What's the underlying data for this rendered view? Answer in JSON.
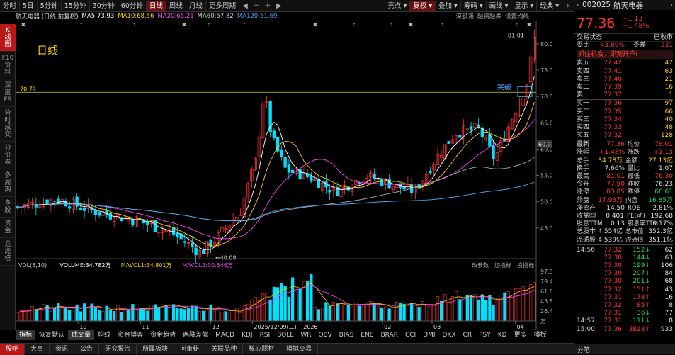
{
  "toolbar": {
    "left": [
      "分时",
      "5日",
      "5分钟",
      "15分钟",
      "30分钟",
      "60分钟",
      "日线",
      "周线",
      "月线",
      "更多周期"
    ],
    "active": "日线",
    "right": [
      "亮点",
      "复权",
      "叠加",
      "筹码",
      "画线",
      "显示",
      "经典"
    ]
  },
  "info": {
    "title": "航天电器 (日线,前复权)",
    "ma": [
      {
        "t": "MA5:73.93",
        "c": "#ffffff"
      },
      {
        "t": "MA10:68.56",
        "c": "#ffcc00"
      },
      {
        "t": "MA20:65.21",
        "c": "#ff44ff"
      },
      {
        "t": "MA60:57.82",
        "c": "#cccccc"
      },
      {
        "t": "MA120:51.69",
        "c": "#44aaff"
      }
    ],
    "right": [
      "深股通",
      "融资融券",
      "设置均线"
    ]
  },
  "left_tabs": [
    {
      "t": "K\n线\n图",
      "active": true
    },
    {
      "t": "F10\n资\n料"
    },
    {
      "t": "深\n度\nF9"
    },
    {
      "t": "分\n时\n成\n交"
    },
    {
      "t": "分\n价\n表"
    },
    {
      "t": "多\n周\n期"
    },
    {
      "t": "多\n股"
    },
    {
      "t": "资\n金"
    },
    {
      "t": "龙\n虎\n榜"
    }
  ],
  "chart_labels": {
    "period": "日线",
    "breakout": "突破",
    "hline": "70.79",
    "high": "81.01",
    "low": "40.08",
    "cur_price": "60.92"
  },
  "y_ticks": [
    "80.00",
    "75.00",
    "70.00",
    "65.00",
    "60.00",
    "55.00",
    "50.00",
    "45.00"
  ],
  "vol": {
    "info": [
      {
        "t": "VOL(5,10)",
        "c": "#cccccc"
      },
      {
        "t": "VOLUME:34.782万",
        "c": "#ffffff"
      },
      {
        "t": "MAVOL1:34.801万",
        "c": "#ffcc00"
      },
      {
        "t": "MAVOL2:30.546万",
        "c": "#ff44ff"
      }
    ],
    "right": [
      "改参数",
      "加指标",
      "换指标"
    ],
    "y_ticks": [
      "97.30",
      "79.47",
      "61.63",
      "43.82",
      "26.40",
      "万"
    ]
  },
  "x_ticks": [
    {
      "t": "10",
      "p": 0.12
    },
    {
      "t": "11",
      "p": 0.24
    },
    {
      "t": "12",
      "p": 0.375
    },
    {
      "t": "2025/12/09(二)",
      "p": 0.455
    },
    {
      "t": "2026",
      "p": 0.55
    },
    {
      "t": "02",
      "p": 0.705
    },
    {
      "t": "03",
      "p": 0.8
    },
    {
      "t": "04",
      "p": 0.96
    }
  ],
  "bottom_tabs": [
    "指标",
    "恢复默认",
    "成交量",
    "均线",
    "资金博弈",
    "资金趋势",
    "两融差额",
    "MACD",
    "KDJ",
    "RSI",
    "BOLL",
    "WR",
    "OBV",
    "BIAS",
    "ENE",
    "BRAR",
    "CCI",
    "DMI",
    "DKX",
    "CR",
    "PSY",
    "KD",
    "更多",
    "模板"
  ],
  "bottom_active": [
    "指标",
    "成交量"
  ],
  "footer": [
    "股吧",
    "大事",
    "资讯",
    "公告",
    "研究报告",
    "所属板块",
    "问董秘",
    "关联品种",
    "核心题材",
    "模拟交易"
  ],
  "quote": {
    "code": "002025",
    "name": "航天电器",
    "price": "77.36",
    "chg": "+1.13",
    "pct": "+1.48%",
    "status_label": "交易状态",
    "status": "已收市",
    "webi": "委比",
    "webi_v": "43.89%",
    "wecha": "委差",
    "wecha_v": "231",
    "promo": "抓住机会，即刻开户!",
    "sell": [
      [
        "卖五",
        "77.42",
        "47"
      ],
      [
        "卖四",
        "77.41",
        "63"
      ],
      [
        "卖三",
        "77.40",
        "21"
      ],
      [
        "卖二",
        "77.39",
        "16"
      ],
      [
        "卖一",
        "77.37",
        "1"
      ]
    ],
    "buy": [
      [
        "买一",
        "77.36",
        "97"
      ],
      [
        "买二",
        "77.35",
        "66"
      ],
      [
        "买三",
        "77.34",
        "40"
      ],
      [
        "买四",
        "77.33",
        "48"
      ],
      [
        "买五",
        "77.32",
        "128"
      ]
    ],
    "stats": [
      [
        "最新",
        "77.36",
        "均价",
        "78.01"
      ],
      [
        "涨幅",
        "+1.48%",
        "涨跌",
        "+1.13"
      ],
      [
        "总手",
        "34.78万",
        "金额",
        "27.13亿"
      ],
      [
        "换手",
        "7.66%",
        "量比",
        "1.07"
      ],
      [
        "最高",
        "81.01",
        "最低",
        "76.30"
      ],
      [
        "今开",
        "77.50",
        "昨收",
        "76.23"
      ],
      [
        "涨停",
        "83.85",
        "跌停",
        "68.61"
      ],
      [
        "外盘",
        "17.93万",
        "内盘",
        "16.85万"
      ],
      [
        "净资产",
        "14.50",
        "ROE",
        "2.81%"
      ],
      [
        "收益㈣",
        "0.401",
        "PE(动)",
        "192.68"
      ],
      [
        "股息TTM",
        "0.13",
        "股息率TTM",
        "0.17%"
      ],
      [
        "总股本",
        "4.554亿",
        "总市值",
        "352.3亿"
      ],
      [
        "流通股",
        "4.539亿",
        "流通值",
        "351.1亿"
      ]
    ],
    "ticks": [
      [
        "14:56",
        "77.32",
        "152",
        "62",
        "down"
      ],
      [
        "",
        "77.30",
        "144",
        "63",
        "down"
      ],
      [
        "",
        "77.30",
        "199",
        "106",
        "down"
      ],
      [
        "",
        "77.30",
        "207",
        "84",
        "down"
      ],
      [
        "",
        "77.30",
        "201",
        "68",
        "down"
      ],
      [
        "",
        "77.32",
        "151",
        "43",
        "up"
      ],
      [
        "",
        "77.31",
        "178",
        "16",
        "up"
      ],
      [
        "",
        "77.32",
        "85",
        "8",
        "up"
      ],
      [
        "",
        "77.31",
        "36",
        "77",
        "down"
      ],
      [
        "14:57",
        "77.31",
        "111",
        "8",
        "down"
      ],
      [
        "15:00",
        "77.36",
        "3813",
        "933",
        "up"
      ]
    ],
    "ticks_label": "分笔"
  }
}
